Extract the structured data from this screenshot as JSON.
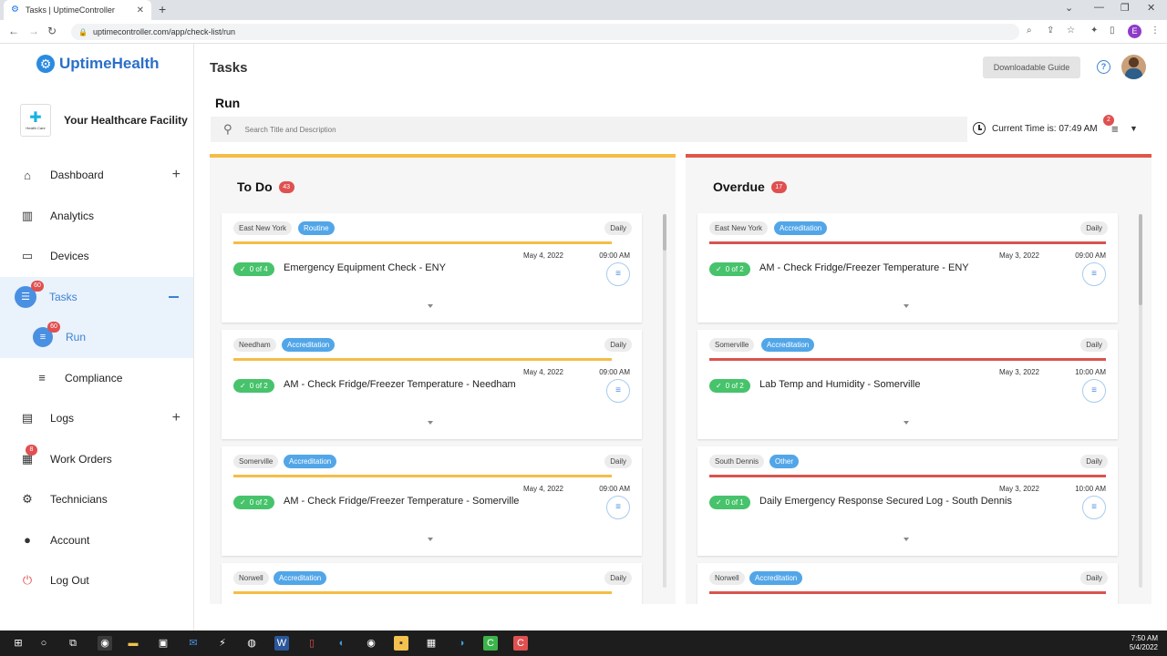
{
  "browser": {
    "tab_title": "Tasks | UptimeController",
    "url": "uptimecontroller.com/app/check-list/run",
    "profile_initial": "E"
  },
  "sidebar": {
    "brand": "UptimeHealth",
    "facility_name": "Your Healthcare Facility",
    "facility_logo_text": "Health Care",
    "items": [
      {
        "label": "Dashboard",
        "icon": "home-icon"
      },
      {
        "label": "Analytics",
        "icon": "bar-chart-icon"
      },
      {
        "label": "Devices",
        "icon": "devices-icon"
      },
      {
        "label": "Tasks",
        "icon": "checklist-icon",
        "badge": "60"
      },
      {
        "label": "Run",
        "icon": "playlist-icon",
        "badge": "60"
      },
      {
        "label": "Compliance",
        "icon": "list-check-icon"
      },
      {
        "label": "Logs",
        "icon": "book-icon"
      },
      {
        "label": "Work Orders",
        "icon": "clipboard-icon",
        "badge": "8"
      },
      {
        "label": "Technicians",
        "icon": "gear-icon"
      },
      {
        "label": "Account",
        "icon": "user-icon"
      },
      {
        "label": "Log Out",
        "icon": "power-icon"
      }
    ]
  },
  "header": {
    "title": "Tasks",
    "download_label": "Downloadable Guide",
    "help_glyph": "?"
  },
  "run": {
    "title": "Run",
    "search_placeholder": "Search Title and Description",
    "current_time": "Current Time is: 07:49 AM",
    "filter_badge": "2"
  },
  "columns": {
    "todo": {
      "title": "To Do",
      "count": "43",
      "cards": [
        {
          "location": "East New York",
          "tag": "Routine",
          "frequency": "Daily",
          "date": "May 4, 2022",
          "time": "09:00 AM",
          "progress": "0 of 4",
          "title": "Emergency Equipment Check - ENY"
        },
        {
          "location": "Needham",
          "tag": "Accreditation",
          "frequency": "Daily",
          "date": "May 4, 2022",
          "time": "09:00 AM",
          "progress": "0 of 2",
          "title": "AM - Check Fridge/Freezer Temperature - Needham"
        },
        {
          "location": "Somerville",
          "tag": "Accreditation",
          "frequency": "Daily",
          "date": "May 4, 2022",
          "time": "09:00 AM",
          "progress": "0 of 2",
          "title": "AM - Check Fridge/Freezer Temperature - Somerville"
        },
        {
          "location": "Norwell",
          "tag": "Accreditation",
          "frequency": "Daily"
        }
      ]
    },
    "overdue": {
      "title": "Overdue",
      "count": "17",
      "cards": [
        {
          "location": "East New York",
          "tag": "Accreditation",
          "frequency": "Daily",
          "date": "May 3, 2022",
          "time": "09:00 AM",
          "progress": "0 of 2",
          "title": "AM - Check Fridge/Freezer Temperature - ENY"
        },
        {
          "location": "Somerville",
          "tag": "Accreditation",
          "frequency": "Daily",
          "date": "May 3, 2022",
          "time": "10:00 AM",
          "progress": "0 of 2",
          "title": "Lab Temp and Humidity - Somerville"
        },
        {
          "location": "South Dennis",
          "tag": "Other",
          "frequency": "Daily",
          "date": "May 3, 2022",
          "time": "10:00 AM",
          "progress": "0 of 1",
          "title": "Daily Emergency Response Secured Log - South Dennis"
        },
        {
          "location": "Norwell",
          "tag": "Accreditation",
          "frequency": "Daily"
        }
      ]
    }
  },
  "taskbar": {
    "time": "7:50 AM",
    "date": "5/4/2022"
  },
  "colors": {
    "accent": "#3b82d6",
    "todo_bar": "#f5bd45",
    "overdue_bar": "#e05648",
    "badge": "#e05050",
    "progress": "#47c36b"
  }
}
